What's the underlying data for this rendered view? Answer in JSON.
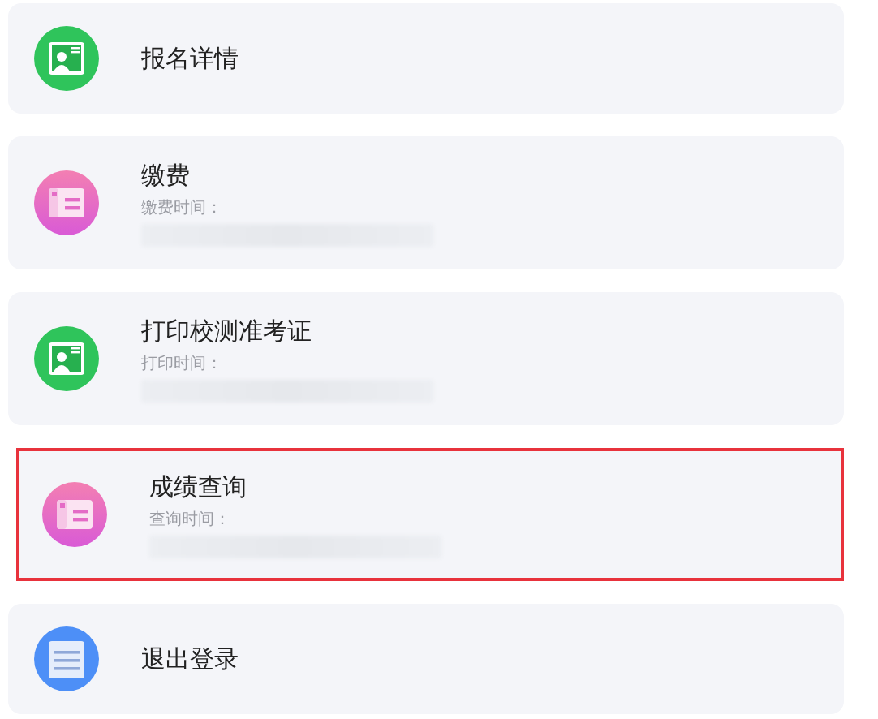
{
  "items": [
    {
      "title": "报名详情",
      "kind": "person",
      "selected": false
    },
    {
      "title": "缴费",
      "subtitle": "缴费时间：",
      "kind": "card",
      "redacted": true,
      "selected": false
    },
    {
      "title": "打印校测准考证",
      "subtitle": "打印时间：",
      "kind": "person",
      "redacted": true,
      "selected": false
    },
    {
      "title": "成绩查询",
      "subtitle": "查询时间：",
      "kind": "card",
      "redacted": true,
      "selected": true
    },
    {
      "title": "退出登录",
      "kind": "list",
      "selected": false
    }
  ]
}
